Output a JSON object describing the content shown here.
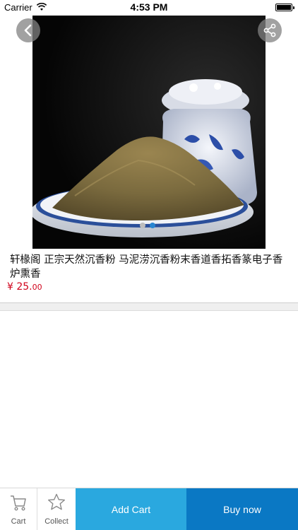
{
  "status_bar": {
    "carrier": "Carrier",
    "time": "4:53 PM",
    "battery_level": 1.0
  },
  "product": {
    "title": "轩椽阁 正宗天然沉香粉 马泥涝沉香粉末香道香拓香篆电子香炉熏香",
    "price_main": "¥ 25.",
    "price_cents": "00",
    "image_description_icon": "incense-powder-photo",
    "carousel_total": 2,
    "carousel_active_index": 1
  },
  "navigation": {
    "back_icon": "chevron-left-icon",
    "share_icon": "share-icon"
  },
  "bottom_bar": {
    "cart_label": "Cart",
    "collect_label": "Collect",
    "add_cart_label": "Add Cart",
    "buy_now_label": "Buy now",
    "add_cart_color": "#2aa8df",
    "buy_now_color": "#0a78c4"
  },
  "colors": {
    "price": "#d0021b",
    "dot_active": "#2a86d1",
    "dot_inactive": "#bdbdbd"
  }
}
